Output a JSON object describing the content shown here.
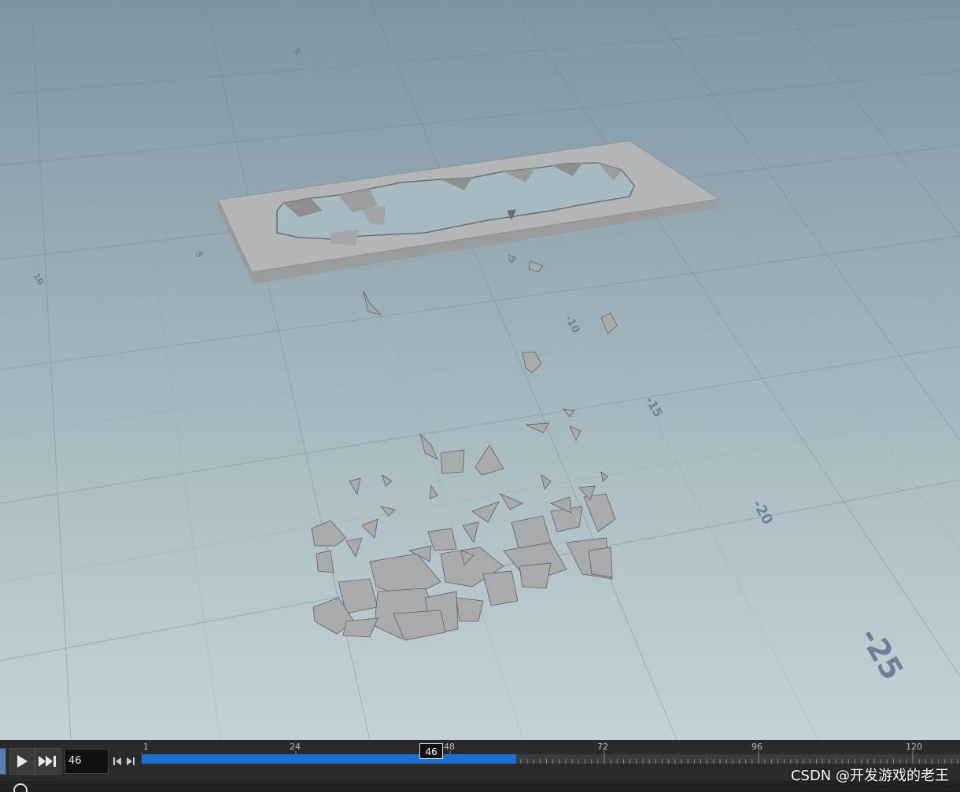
{
  "viewport": {
    "grid_labels": [
      "5",
      "0",
      "5",
      "-5",
      "-10",
      "-15",
      "-20",
      "-25",
      "10"
    ]
  },
  "timeline": {
    "current_frame": "46",
    "marker_label": "46",
    "tick_labels": [
      "1",
      "24",
      "48",
      "72",
      "96",
      "120"
    ],
    "range_fill": 0.39
  },
  "watermark": "CSDN @开发游戏的老王",
  "colors": {
    "accent": "#1a6fd0",
    "viewport_top": "#7f97a3",
    "viewport_bottom": "#c2d0d3"
  },
  "icons": {
    "play": "play-icon",
    "skip_end": "skip-to-end-icon",
    "step_back": "step-back-icon",
    "step_forward": "step-forward-icon"
  }
}
